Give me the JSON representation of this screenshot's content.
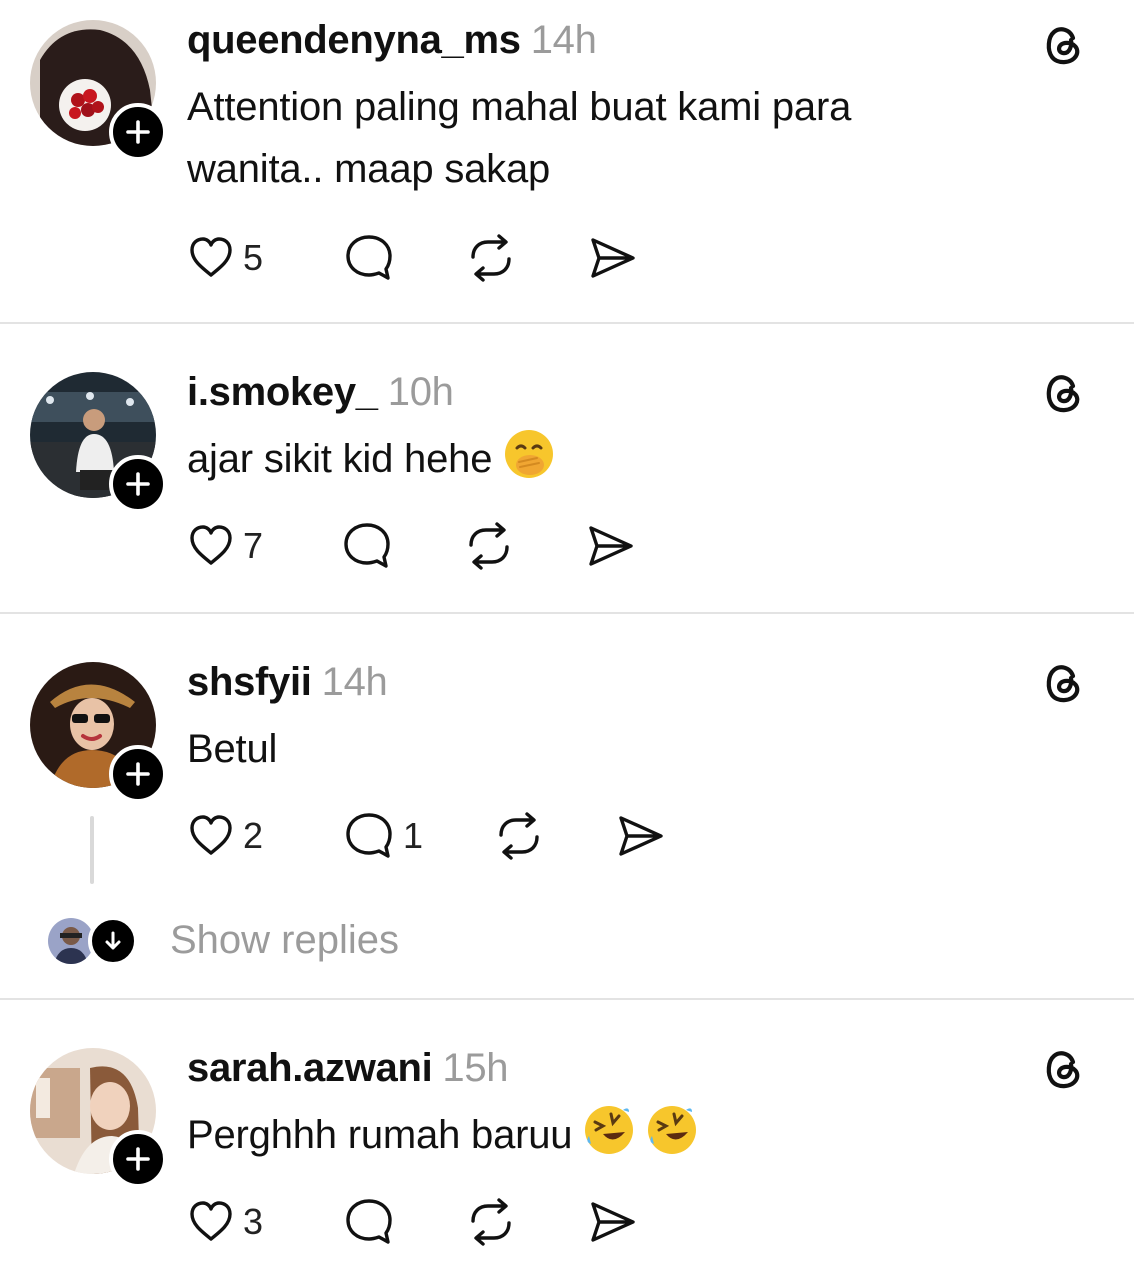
{
  "posts": [
    {
      "username": "queendenyna_ms",
      "time": "14h",
      "text": "Attention paling mahal buat kami para wanita.. maap sakap",
      "likes": "5",
      "replies": "",
      "avatar_colors": [
        "#2a1c1a",
        "#d8cfc7"
      ]
    },
    {
      "username": "i.smokey_",
      "time": "10h",
      "text": "ajar sikit kid hehe",
      "likes": "7",
      "replies": "",
      "avatar_colors": [
        "#1f2a33",
        "#9aa8b2"
      ]
    },
    {
      "username": "shsfyii",
      "time": "14h",
      "text": "Betul",
      "likes": "2",
      "replies": "1",
      "avatar_colors": [
        "#2a1a14",
        "#b8833f"
      ]
    },
    {
      "username": "sarah.azwani",
      "time": "15h",
      "text": "Perghhh rumah baruu",
      "likes": "3",
      "replies": "",
      "avatar_colors": [
        "#c9a78c",
        "#e9ddd2"
      ]
    }
  ],
  "show_replies_label": "Show replies",
  "icons": {
    "like": "heart-icon",
    "comment": "comment-bubble-icon",
    "repost": "repost-icon",
    "share": "share-send-icon",
    "brand": "threads-logo-icon",
    "follow": "plus-icon"
  }
}
